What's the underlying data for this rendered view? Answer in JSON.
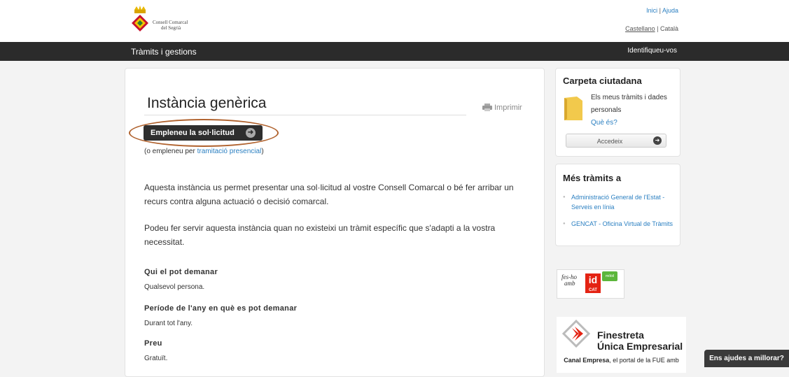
{
  "header": {
    "logo_line1": "Consell Comarcal",
    "logo_line2": "del Segrià",
    "link_inici": "Inici",
    "link_ajuda": "Ajuda",
    "lang_castellano": "Castellano",
    "lang_catala": "Català",
    "sep": "|"
  },
  "nav": {
    "title": "Tràmits i gestions",
    "login": "Identifiqueu-vos"
  },
  "main": {
    "title": "Instància genèrica",
    "print_label": "Imprimir",
    "cta_label": "Empleneu la sol·licitud",
    "alt_prefix": "(o empleneu per ",
    "alt_link": "tramitació presencial",
    "alt_suffix": ")",
    "para1": "Aquesta instància us permet presentar una sol·licitud al vostre Consell Comarcal o bé fer arribar un recurs contra alguna actuació o decisió comarcal.",
    "para2": "Podeu fer servir aquesta instància quan no existeixi un tràmit específic que s'adapti a la vostra necessitat.",
    "sections": [
      {
        "heading": "Qui el pot demanar",
        "value": "Qualsevol persona."
      },
      {
        "heading": "Període de l'any en què es pot demanar",
        "value": "Durant tot l'any."
      },
      {
        "heading": "Preu",
        "value": "Gratuït."
      }
    ]
  },
  "sidebar": {
    "carpeta_title": "Carpeta ciutadana",
    "carpeta_desc": "Els meus tràmits i dades personals",
    "carpeta_link": "Què és?",
    "accedeix_label": "Accedeix",
    "mes_title": "Més tràmits a",
    "mes_links": [
      "Administració General de l'Estat - Serveis en línia",
      "GENCAT - Oficina Virtual de Tràmits"
    ],
    "idcat_fes": "fes-ho",
    "idcat_amb": "amb",
    "idcat_id": "id",
    "idcat_cat": "CAT",
    "idcat_mobil": "mòbil",
    "feu_line1": "Finestreta",
    "feu_line2": "Única Empresarial",
    "feu_bold": "Canal Empresa",
    "feu_rest": ", el portal de la FUE amb"
  },
  "feedback_label": "Ens ajudes a millorar?",
  "colors": {
    "accent_link": "#2a7fc1",
    "navbar": "#2b2b2b",
    "cta_oval": "#b0622e",
    "idcat_red": "#e42313"
  }
}
